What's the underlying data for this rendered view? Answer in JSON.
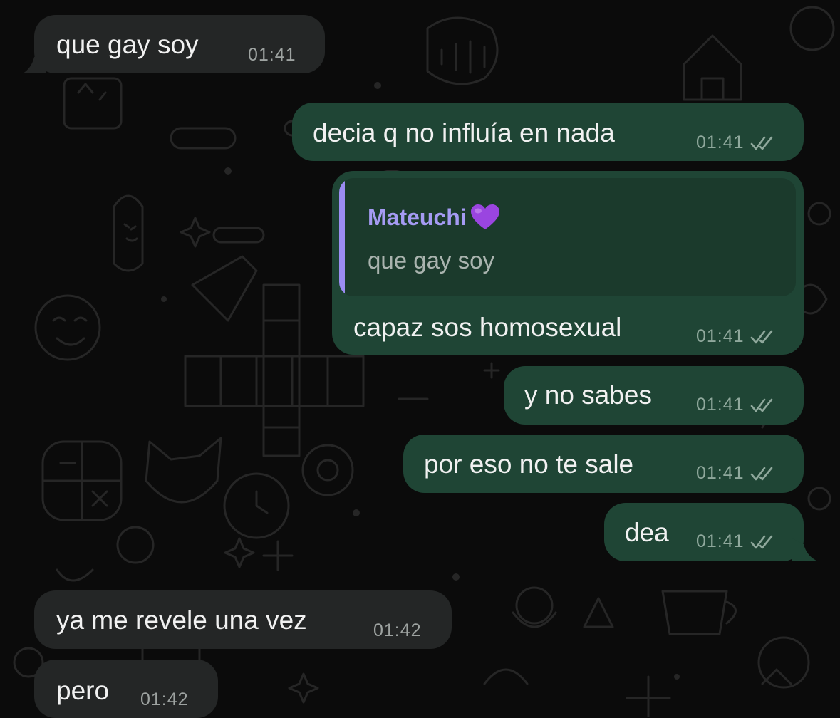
{
  "conversation": {
    "messages": [
      {
        "text": "que gay soy",
        "time": "01:41",
        "direction": "incoming"
      },
      {
        "text": "decia q no influía en nada",
        "time": "01:41",
        "direction": "outgoing",
        "status": "read"
      },
      {
        "text": "capaz sos homosexual",
        "time": "01:41",
        "direction": "outgoing",
        "status": "read",
        "reply_to": {
          "author": "Mateuchi",
          "text": "que gay soy"
        }
      },
      {
        "text": "y no sabes",
        "time": "01:41",
        "direction": "outgoing",
        "status": "read"
      },
      {
        "text": "por eso no te sale",
        "time": "01:41",
        "direction": "outgoing",
        "status": "read"
      },
      {
        "text": "dea",
        "time": "01:41",
        "direction": "outgoing",
        "status": "read"
      },
      {
        "text": "ya me revele una vez",
        "time": "01:42",
        "direction": "incoming"
      },
      {
        "text": "pero",
        "time": "01:42",
        "direction": "incoming"
      }
    ]
  },
  "icons": {
    "read_receipt": "double-check-icon",
    "author_emoji": "purple-heart-icon"
  },
  "colors": {
    "background": "#0b0b0b",
    "incoming_bubble": "#242626",
    "outgoing_bubble": "#1f4535",
    "quote_accent": "#9b8cf2",
    "quote_author": "#a59bf3"
  }
}
